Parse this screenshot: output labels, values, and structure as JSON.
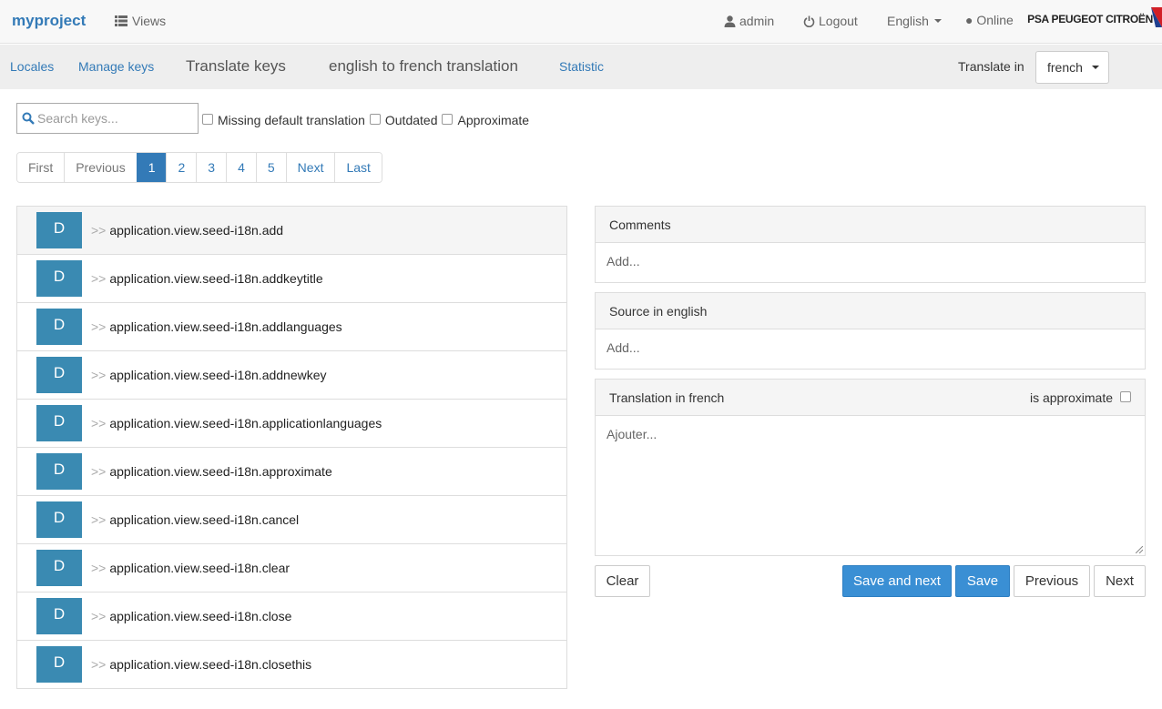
{
  "navbar": {
    "brand": "myproject",
    "views_label": "Views",
    "user_label": "admin",
    "logout_label": "Logout",
    "language_label": "English",
    "online_label": "● Online",
    "logo_text": "PSA PEUGEOT CITROËN"
  },
  "subnav": {
    "locales": "Locales",
    "manage_keys": "Manage keys",
    "translate_keys": "Translate keys",
    "translation_name": "english to french translation",
    "statistic": "Statistic",
    "translate_in_label": "Translate in",
    "target_language": "french"
  },
  "filters": {
    "search_placeholder": "Search keys...",
    "missing_default": "Missing default translation",
    "outdated": "Outdated",
    "approximate": "Approximate"
  },
  "pagination": {
    "first": "First",
    "previous": "Previous",
    "pages": [
      "1",
      "2",
      "3",
      "4",
      "5"
    ],
    "current": "1",
    "next": "Next",
    "last": "Last"
  },
  "keys": [
    {
      "badge": "D",
      "arrows": ">>",
      "name": "application.view.seed-i18n.add"
    },
    {
      "badge": "D",
      "arrows": ">>",
      "name": "application.view.seed-i18n.addkeytitle"
    },
    {
      "badge": "D",
      "arrows": ">>",
      "name": "application.view.seed-i18n.addlanguages"
    },
    {
      "badge": "D",
      "arrows": ">>",
      "name": "application.view.seed-i18n.addnewkey"
    },
    {
      "badge": "D",
      "arrows": ">>",
      "name": "application.view.seed-i18n.applicationlanguages"
    },
    {
      "badge": "D",
      "arrows": ">>",
      "name": "application.view.seed-i18n.approximate"
    },
    {
      "badge": "D",
      "arrows": ">>",
      "name": "application.view.seed-i18n.cancel"
    },
    {
      "badge": "D",
      "arrows": ">>",
      "name": "application.view.seed-i18n.clear"
    },
    {
      "badge": "D",
      "arrows": ">>",
      "name": "application.view.seed-i18n.close"
    },
    {
      "badge": "D",
      "arrows": ">>",
      "name": "application.view.seed-i18n.closethis"
    }
  ],
  "panels": {
    "comments_title": "Comments",
    "comments_body": "Add...",
    "source_title": "Source in english",
    "source_body": "Add...",
    "translation_title": "Translation in french",
    "is_approximate": "is approximate",
    "translation_placeholder": "Ajouter..."
  },
  "actions": {
    "clear": "Clear",
    "save_and_next": "Save and next",
    "save": "Save",
    "previous": "Previous",
    "next": "Next"
  },
  "colors": {
    "accent": "#337ab7",
    "badge": "#3a8ab2",
    "primary_button": "#3a8fd4"
  }
}
